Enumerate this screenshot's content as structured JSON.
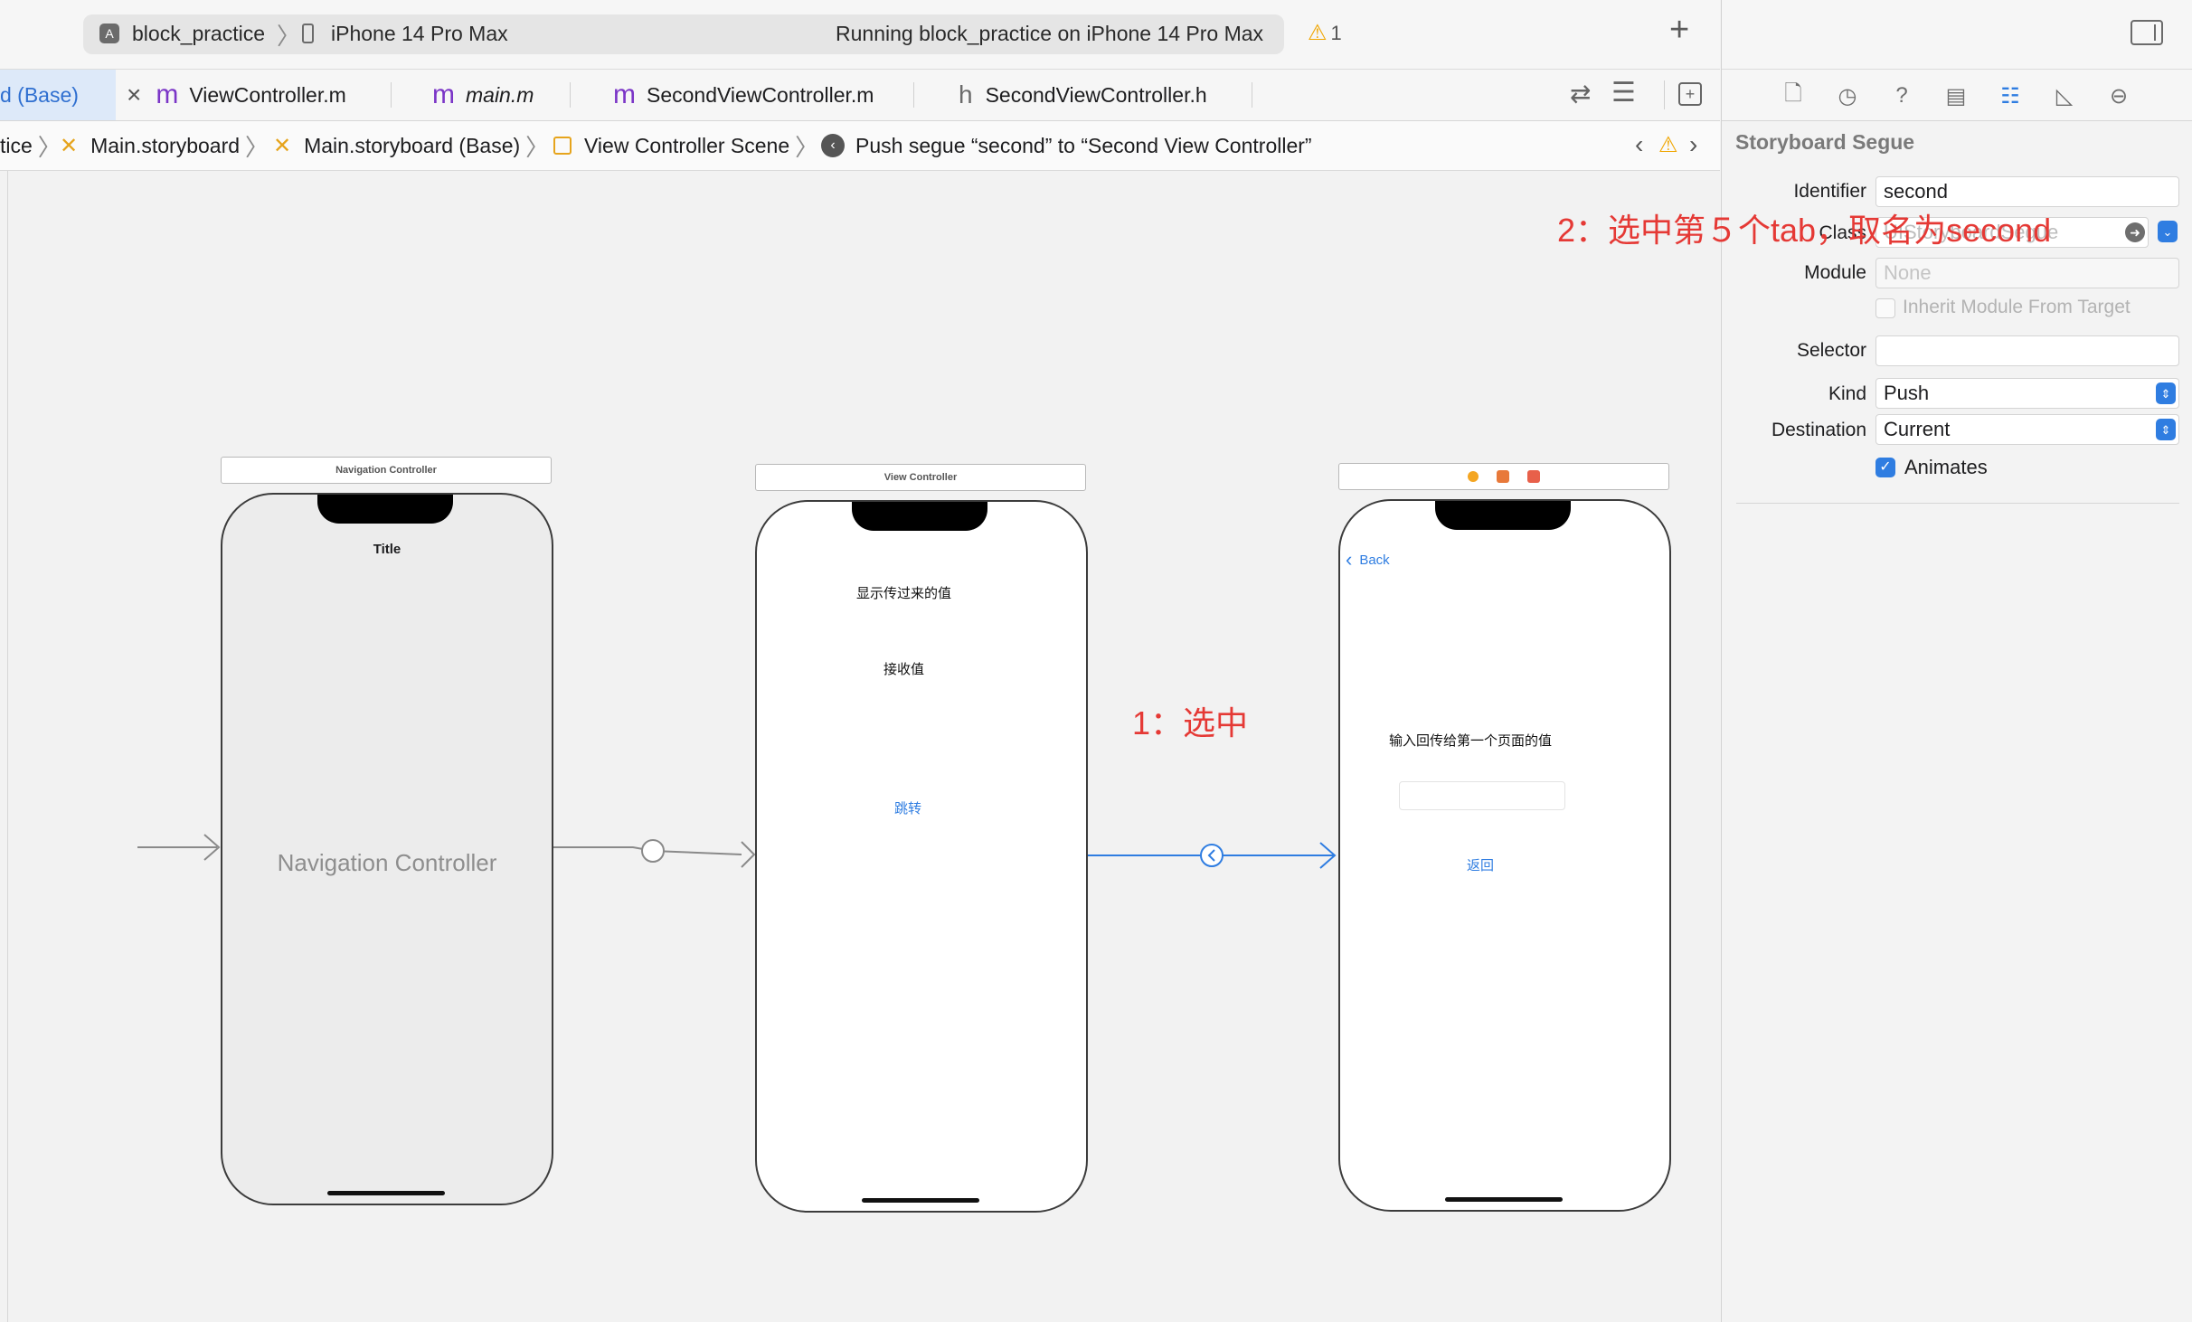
{
  "toolbar": {
    "scheme": "block_practice",
    "device": "iPhone 14 Pro Max",
    "status": "Running block_practice on iPhone 14 Pro Max",
    "warning_count": "1",
    "add_icon": "plus-icon"
  },
  "tabs": [
    {
      "label": "d (Base)",
      "active": true
    },
    {
      "label": "ViewController.m",
      "glyph": "m"
    },
    {
      "label": "main.m",
      "glyph": "m",
      "italic": true
    },
    {
      "label": "SecondViewController.m",
      "glyph": "m"
    },
    {
      "label": "SecondViewController.h",
      "glyph": "h"
    }
  ],
  "jumpbar": {
    "items": [
      "tice",
      "Main.storyboard",
      "Main.storyboard (Base)",
      "View Controller Scene",
      "Push segue “second” to “Second View Controller”"
    ]
  },
  "canvas": {
    "nav_controller": {
      "scene_title": "Navigation Controller",
      "nav_title": "Title",
      "placeholder": "Navigation Controller"
    },
    "view_controller": {
      "scene_title": "View Controller",
      "label_display": "显示传过来的值",
      "label_receive": "接收值",
      "button_jump": "跳转"
    },
    "second_view_controller": {
      "back_label": "Back",
      "prompt": "输入回传给第一个页面的值",
      "button_return": "返回"
    },
    "annotation_1": "1：选中",
    "annotation_2": "2：选中第５个tab，取名为second"
  },
  "inspector": {
    "title": "Storyboard Segue",
    "identifier_label": "Identifier",
    "identifier_value": "second",
    "class_label": "Class",
    "class_placeholder": "UIStoryboardSegue",
    "module_label": "Module",
    "module_value": "None",
    "inherit_label": "Inherit Module From Target",
    "selector_label": "Selector",
    "selector_value": "",
    "kind_label": "Kind",
    "kind_value": "Push",
    "destination_label": "Destination",
    "destination_value": "Current",
    "animates_label": "Animates",
    "animates_checked": true,
    "accent_color": "#2f7de1"
  }
}
